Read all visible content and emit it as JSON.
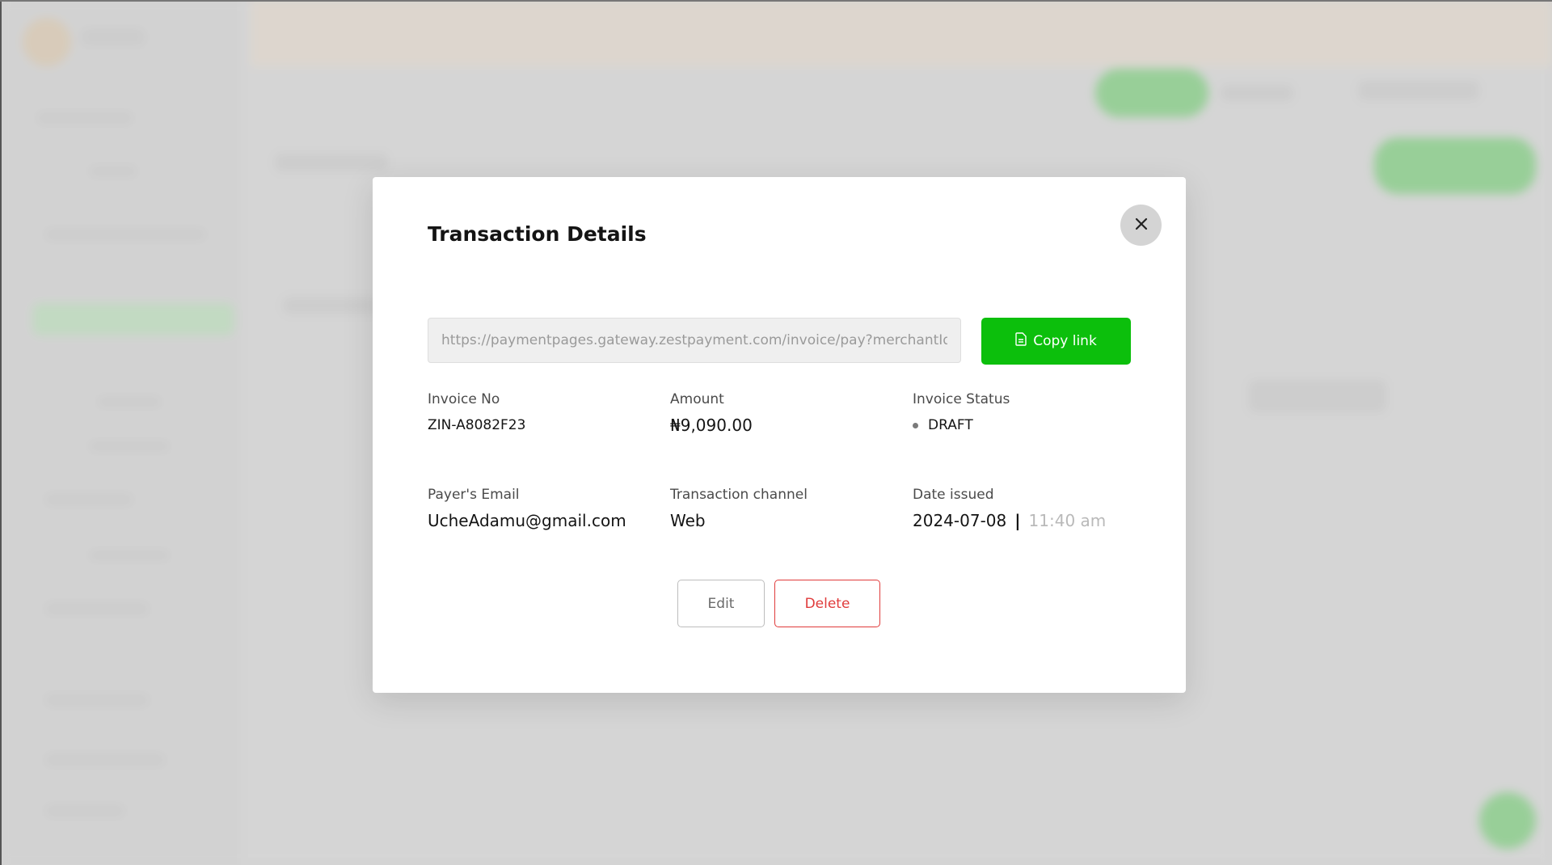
{
  "modal": {
    "title": "Transaction Details",
    "close_icon": "close-icon",
    "link": {
      "value": "https://paymentpages.gateway.zestpayment.com/invoice/pay?merchantId=Z",
      "copy_label": "Copy link",
      "copy_icon": "document-icon"
    },
    "fields": {
      "invoice_no": {
        "label": "Invoice No",
        "value": "ZIN-A8082F23"
      },
      "amount": {
        "label": "Amount",
        "value": "₦9,090.00"
      },
      "invoice_status": {
        "label": "Invoice Status",
        "value": "DRAFT"
      },
      "payer_email": {
        "label": "Payer's Email",
        "value": "UcheAdamu@gmail.com"
      },
      "transaction_channel": {
        "label": "Transaction channel",
        "value": "Web"
      },
      "date_issued": {
        "label": "Date issued",
        "date": "2024-07-08",
        "separator": "|",
        "time": "11:40 am"
      }
    },
    "actions": {
      "edit_label": "Edit",
      "delete_label": "Delete"
    }
  },
  "colors": {
    "accent_green": "#0cbf0c",
    "danger_red": "#e03b3b",
    "overlay": "#d9d9d9"
  }
}
